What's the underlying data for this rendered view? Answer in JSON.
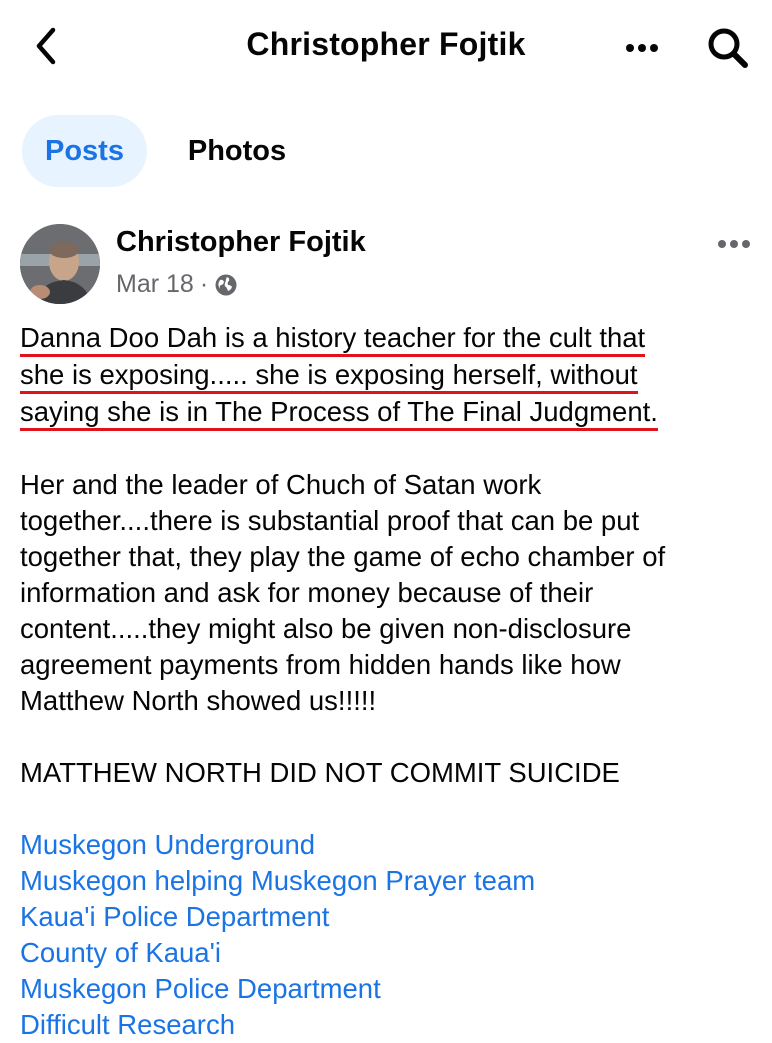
{
  "header": {
    "title": "Christopher Fojtik",
    "back_icon": "chevron-left-icon",
    "more_icon": "more-horizontal-icon",
    "search_icon": "search-icon"
  },
  "tabs": [
    {
      "label": "Posts",
      "active": true
    },
    {
      "label": "Photos",
      "active": false
    }
  ],
  "post": {
    "author": "Christopher Fojtik",
    "date": "Mar 18",
    "separator": "·",
    "audience_icon": "globe-icon",
    "highlighted_lines": [
      "Danna Doo Dah is a history teacher for the cult that",
      "she is exposing..... she is exposing herself, without",
      "saying she is in The Process of The Final Judgment."
    ],
    "paragraph2_lines": [
      "Her and the leader of Chuch of Satan work",
      "together....there is substantial proof that can be put",
      "together that, they play the game of echo chamber of",
      "information and ask for money because of their",
      "content.....they might also be given non-disclosure",
      "agreement payments from hidden hands like how",
      "Matthew North showed us!!!!!"
    ],
    "paragraph3": "MATTHEW NORTH DID NOT COMMIT SUICIDE",
    "tags": [
      "Muskegon Underground",
      "Muskegon helping Muskegon Prayer team",
      "Kaua'i Police Department",
      "County of Kaua'i",
      "Muskegon Police Department",
      "Difficult Research"
    ]
  },
  "colors": {
    "link": "#1b74e4",
    "tab_active_bg": "#e7f3ff",
    "underline": "#e0121b",
    "meta": "#65676b"
  }
}
